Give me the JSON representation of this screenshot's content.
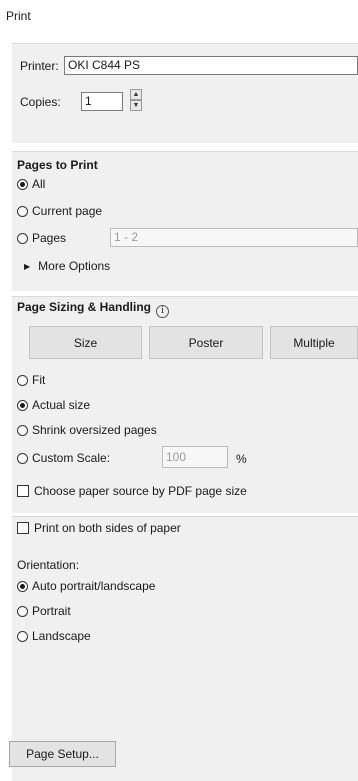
{
  "window": {
    "title": "Print"
  },
  "printer": {
    "label": "Printer:",
    "value": "OKI C844 PS"
  },
  "copies": {
    "label": "Copies:",
    "value": "1",
    "up_icon": "caret-up-icon",
    "down_icon": "caret-down-icon"
  },
  "pages_to_print": {
    "heading": "Pages to Print",
    "options": [
      {
        "label": "All",
        "checked": true
      },
      {
        "label": "Current page",
        "checked": false
      },
      {
        "label": "Pages",
        "checked": false
      }
    ],
    "pages_range": "1 - 2",
    "more_options": "More Options",
    "more_options_icon": "triangle-right-icon"
  },
  "sizing": {
    "heading": "Page Sizing & Handling",
    "info_icon": "info-icon",
    "info_glyph": "i",
    "tabs": [
      "Size",
      "Poster",
      "Multiple"
    ],
    "options": [
      {
        "label": "Fit",
        "checked": false
      },
      {
        "label": "Actual size",
        "checked": true
      },
      {
        "label": "Shrink oversized pages",
        "checked": false
      },
      {
        "label": "Custom Scale:",
        "checked": false
      }
    ],
    "custom_scale_value": "100",
    "percent": "%",
    "paper_source_label": "Choose paper source by PDF page size",
    "paper_source_checked": false
  },
  "duplex": {
    "label": "Print on both sides of paper",
    "checked": false
  },
  "orientation": {
    "heading": "Orientation:",
    "options": [
      {
        "label": "Auto portrait/landscape",
        "checked": true
      },
      {
        "label": "Portrait",
        "checked": false
      },
      {
        "label": "Landscape",
        "checked": false
      }
    ]
  },
  "page_setup": {
    "label": "Page Setup..."
  }
}
